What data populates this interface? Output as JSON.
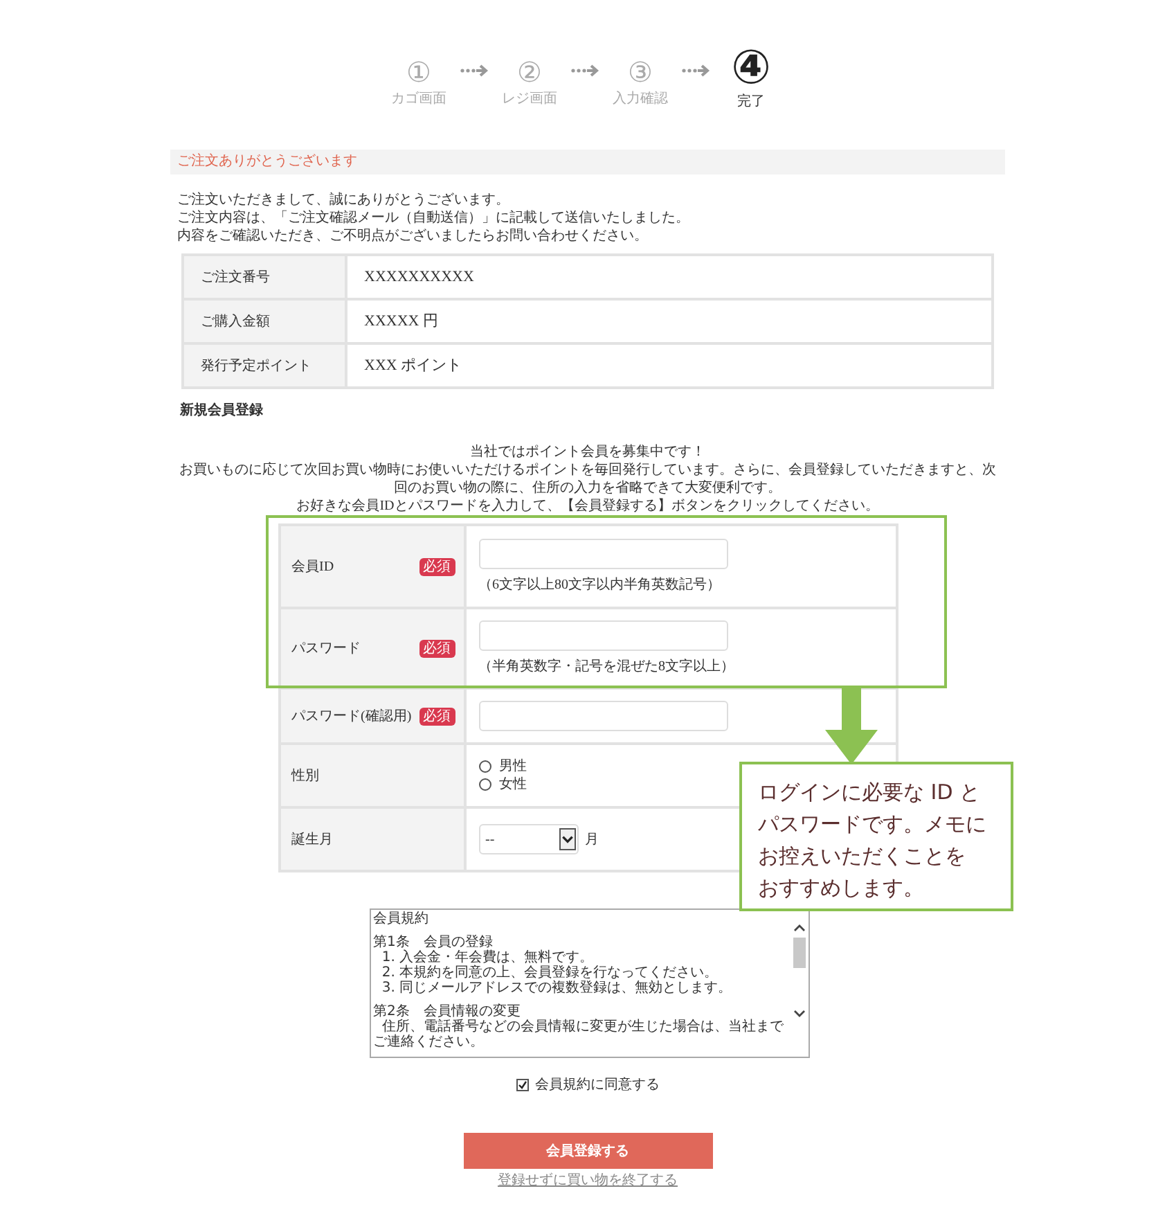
{
  "steps": [
    {
      "number": "①",
      "label": "カゴ画面",
      "selected": false
    },
    {
      "number": "②",
      "label": "レジ画面",
      "selected": false
    },
    {
      "number": "③",
      "label": "入力確認",
      "selected": false
    },
    {
      "number": "④",
      "label": "完了",
      "selected": true
    }
  ],
  "thanks_header": "ご注文ありがとうございます",
  "thanks_lines": [
    "ご注文いただきまして、誠にありがとうございます。",
    "ご注文内容は、「ご注文確認メール（自動送信）」に記載して送信いたしました。",
    "内容をご確認いただき、ご不明点がございましたらお問い合わせください。"
  ],
  "order_table": [
    {
      "label": "ご注文番号",
      "value": "XXXXXXXXXX"
    },
    {
      "label": "ご購入金額",
      "value": "XXXXX 円"
    },
    {
      "label": "発行予定ポイント",
      "value": "XXX ポイント"
    }
  ],
  "registration_title": "新規会員登録",
  "intro_lines": [
    "当社ではポイント会員を募集中です！",
    "お買いものに応じて次回お買い物時にお使いいただけるポイントを毎回発行しています。さらに、会員登録していただきますと、次回のお買い物の際に、住所の入力を省略できて大変便利です。",
    "お好きな会員IDとパスワードを入力して、【会員登録する】ボタンをクリックしてください。"
  ],
  "form_rows": [
    {
      "kind": "text",
      "label": "会員ID",
      "required": true,
      "badge": "必須",
      "hint": "（6文字以上80文字以内半角英数記号）"
    },
    {
      "kind": "text",
      "label": "パスワード",
      "required": true,
      "badge": "必須",
      "hint": "（半角英数字・記号を混ぜた8文字以上）"
    },
    {
      "kind": "text",
      "label": "パスワード(確認用)",
      "required": true,
      "badge": "必須"
    },
    {
      "kind": "radio",
      "label": "性別",
      "options": [
        {
          "label": "男性",
          "selected": false
        },
        {
          "label": "女性",
          "selected": false
        }
      ]
    },
    {
      "kind": "select",
      "label": "誕生月",
      "value": "--",
      "unit": "月"
    }
  ],
  "callout_lines": [
    "ログインに必要な ID と",
    "パスワードです。メモに",
    "お控えいただくことを",
    "おすすめします。"
  ],
  "terms_paragraphs": [
    [
      "会員規約"
    ],
    [
      "第1条　会員の登録",
      "  1. 入会金・年会費は、無料です。",
      "  2. 本規約を同意の上、会員登録を行なってください。",
      "  3. 同じメールアドレスでの複数登録は、無効とします。"
    ],
    [
      "第2条　会員情報の変更",
      "  住所、電話番号などの会員情報に変更が生じた場合は、当社まで",
      "ご連絡ください。"
    ]
  ],
  "agree": {
    "label": "会員規約に同意する",
    "checked": true
  },
  "submit_button": "会員登録する",
  "skip_link": "登録せずに買い物を終了する"
}
